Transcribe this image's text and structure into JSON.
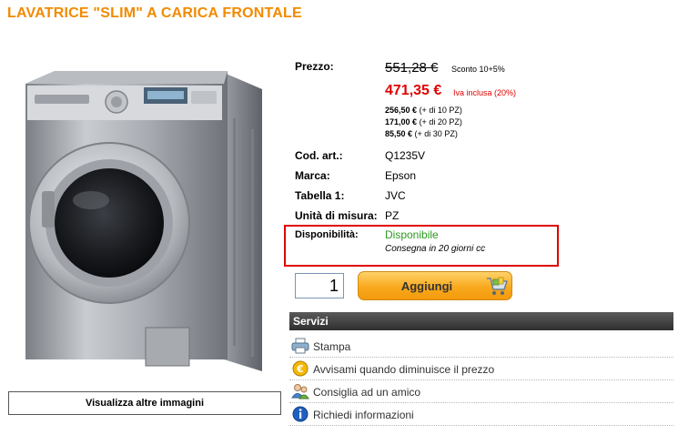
{
  "product": {
    "title": "LAVATRICE \"SLIM\" A CARICA FRONTALE",
    "more_images_label": "Visualizza altre immagini"
  },
  "price": {
    "label": "Prezzo:",
    "old_price": "551,28 €",
    "discount_note": "Sconto 10+5%",
    "new_price": "471,35 €",
    "vat_note": "Iva inclusa (20%)",
    "tiers": [
      {
        "price": "256,50 €",
        "qty": "(+ di 10 PZ)"
      },
      {
        "price": "171,00 €",
        "qty": "(+ di 20 PZ)"
      },
      {
        "price": "85,50 €",
        "qty": "(+ di 30 PZ)"
      }
    ]
  },
  "details": [
    {
      "label": "Cod. art.:",
      "value": "Q1235V"
    },
    {
      "label": "Marca:",
      "value": "Epson"
    },
    {
      "label": "Tabella 1:",
      "value": "JVC"
    },
    {
      "label": "Unità di misura:",
      "value": "PZ"
    }
  ],
  "availability": {
    "label": "Disponibilità:",
    "status": "Disponibile",
    "delivery": "Consegna in 20 giorni cc",
    "status_color": "#2d9a1f",
    "highlight_color": "#e00000"
  },
  "cart": {
    "quantity": "1",
    "add_label": "Aggiungi"
  },
  "services": {
    "header": "Servizi",
    "items": [
      {
        "label": "Stampa",
        "icon": "printer-icon"
      },
      {
        "label": "Avvisami quando diminuisce il prezzo",
        "icon": "coin-alert-icon"
      },
      {
        "label": "Consiglia ad un amico",
        "icon": "friends-icon"
      },
      {
        "label": "Richiedi informazioni",
        "icon": "info-icon"
      }
    ]
  },
  "colors": {
    "title": "#f28a00",
    "price": "#e00000",
    "button": "#f9a91e"
  }
}
